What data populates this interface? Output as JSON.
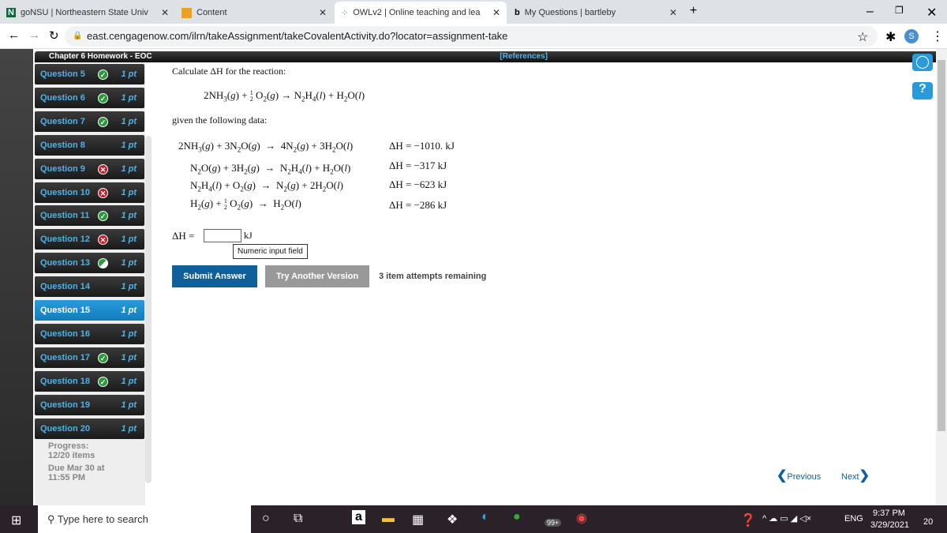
{
  "browser": {
    "tabs": [
      {
        "label": "goNSU | Northeastern State Univ"
      },
      {
        "label": "Content"
      },
      {
        "label": "OWLv2 | Online teaching and lea"
      },
      {
        "label": "My Questions | bartleby"
      }
    ],
    "url": "east.cengagenow.com/ilrn/takeAssignment/takeCovalentActivity.do?locator=assignment-take",
    "profile": "S"
  },
  "header": {
    "title": "Chapter 6 Homework - EOC",
    "references": "[References]"
  },
  "questions": [
    {
      "label": "Question 5",
      "pts": "1 pt",
      "status": "correct"
    },
    {
      "label": "Question 6",
      "pts": "1 pt",
      "status": "correct"
    },
    {
      "label": "Question 7",
      "pts": "1 pt",
      "status": "correct"
    },
    {
      "label": "Question 8",
      "pts": "1 pt",
      "status": ""
    },
    {
      "label": "Question 9",
      "pts": "1 pt",
      "status": "incorrect"
    },
    {
      "label": "Question 10",
      "pts": "1 pt",
      "status": "incorrect"
    },
    {
      "label": "Question 11",
      "pts": "1 pt",
      "status": "correct"
    },
    {
      "label": "Question 12",
      "pts": "1 pt",
      "status": "incorrect"
    },
    {
      "label": "Question 13",
      "pts": "1 pt",
      "status": "partial"
    },
    {
      "label": "Question 14",
      "pts": "1 pt",
      "status": ""
    },
    {
      "label": "Question 15",
      "pts": "1 pt",
      "status": "current"
    },
    {
      "label": "Question 16",
      "pts": "1 pt",
      "status": ""
    },
    {
      "label": "Question 17",
      "pts": "1 pt",
      "status": "correct"
    },
    {
      "label": "Question 18",
      "pts": "1 pt",
      "status": "correct"
    },
    {
      "label": "Question 19",
      "pts": "1 pt",
      "status": ""
    },
    {
      "label": "Question 20",
      "pts": "1 pt",
      "status": ""
    }
  ],
  "progress": {
    "label": "Progress:",
    "items": "12/20 items",
    "due1": "Due Mar 30 at",
    "due2": "11:55 PM"
  },
  "problem": {
    "prompt": "Calculate ΔH for the reaction:",
    "given": "given the following data:",
    "dh": [
      "ΔH = −1010. kJ",
      "ΔH = −317 kJ",
      "ΔH = −623 kJ",
      "ΔH = −286 kJ"
    ],
    "answer_label": "ΔH =",
    "answer_value": "",
    "unit": "kJ",
    "tooltip": "Numeric input field",
    "submit": "Submit Answer",
    "another": "Try Another Version",
    "attempts": "3 item attempts remaining"
  },
  "nav": {
    "previous": "Previous",
    "next": "Next"
  },
  "taskbar": {
    "search": "Type here to search",
    "lang": "ENG",
    "time": "9:37 PM",
    "date": "3/29/2021",
    "badge": "99+",
    "notif": "20"
  },
  "colors": {
    "accent": "#0f6fb0",
    "correct": "#2a9a3a",
    "incorrect": "#c8202a"
  }
}
